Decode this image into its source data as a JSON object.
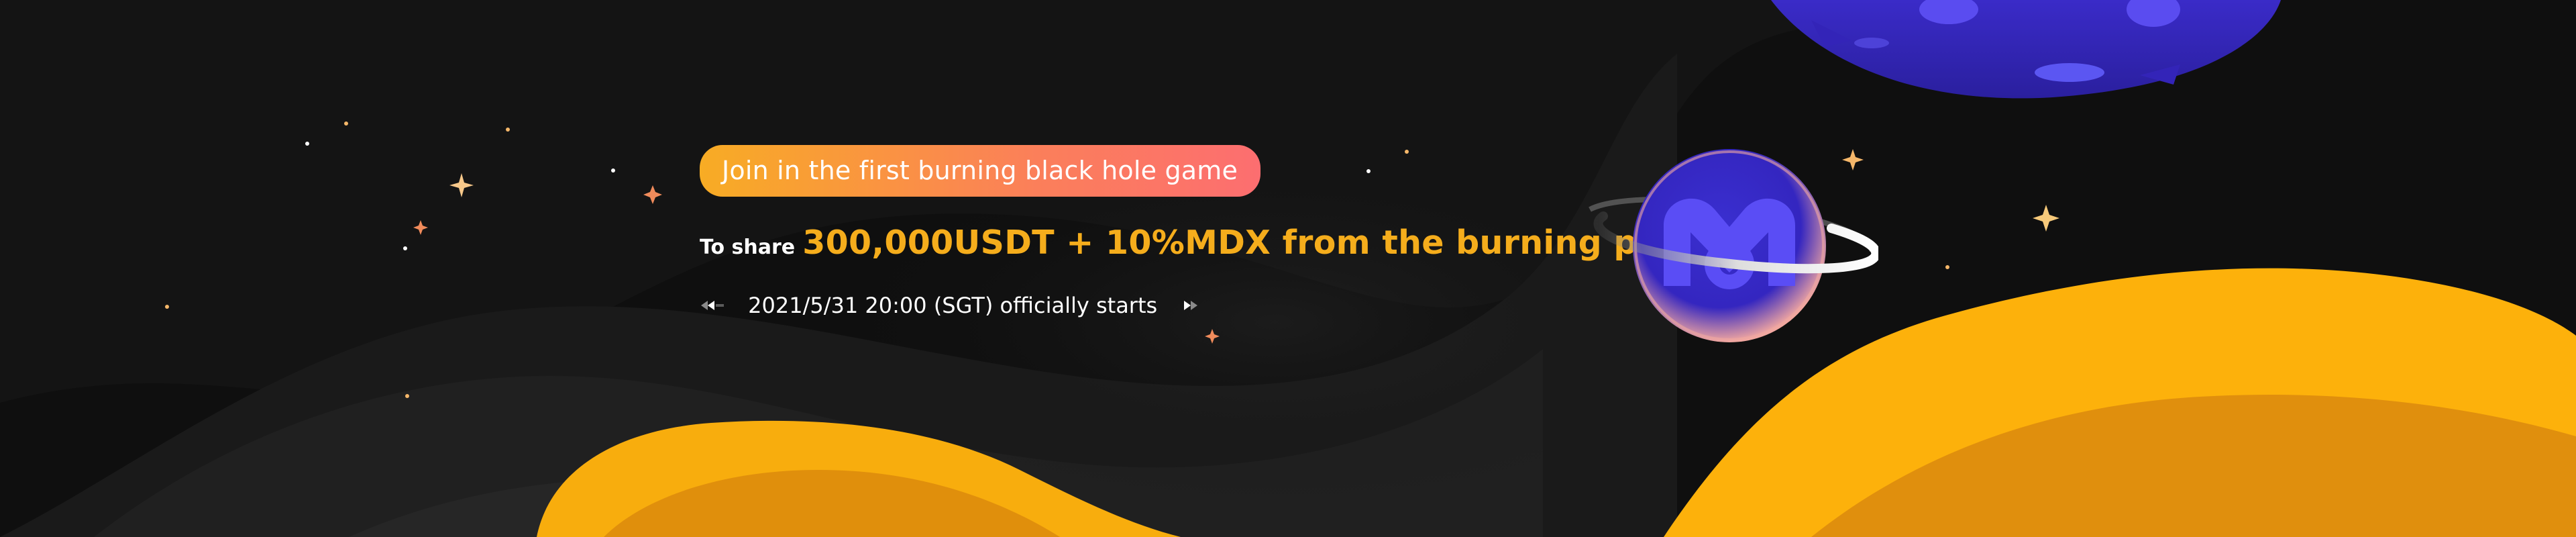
{
  "banner": {
    "tag_label": "Join in the first burning black hole game",
    "share_prefix": "To share",
    "share_highlight": "300,000USDT + 10%MDX from the burning pool",
    "start_text": "2021/5/31 20:00 (SGT) officially starts",
    "colors": {
      "background": "#0f0f0f",
      "accent_yellow": "#f5ad1c",
      "pill_gradient_start": "#f8ac24",
      "pill_gradient_end": "#fc6e70",
      "planet_purple": "#3f2fd2",
      "logo_blue": "#4a3df0"
    },
    "icons": {
      "left_arrows": "double-left-arrow-icon",
      "right_arrows": "double-right-arrow-icon",
      "logo": "mdex-logo-icon",
      "planet": "planet-icon",
      "sparkles": "sparkle-star-icon"
    }
  }
}
